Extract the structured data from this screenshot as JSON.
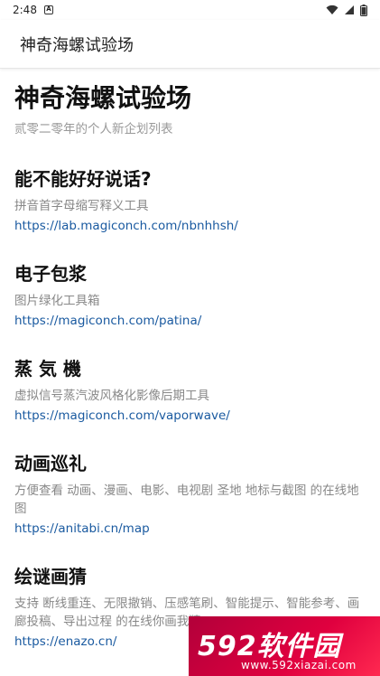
{
  "status": {
    "time": "2:48",
    "badge": "A"
  },
  "app_bar": {
    "title": "神奇海螺试验场"
  },
  "header": {
    "title": "神奇海螺试验场",
    "subtitle": "贰零二零年的个人新企划列表"
  },
  "projects": [
    {
      "title": "能不能好好说话?",
      "desc": "拼音首字母缩写释义工具",
      "link": "https://lab.magiconch.com/nbnhhsh/"
    },
    {
      "title": "电子包浆",
      "desc": "图片绿化工具箱",
      "link": "https://magiconch.com/patina/"
    },
    {
      "title": "蒸 気 機",
      "desc": "虚拟信号蒸汽波风格化影像后期工具",
      "link": "https://magiconch.com/vaporwave/"
    },
    {
      "title": "动画巡礼",
      "desc": "方便查看 动画、漫画、电影、电视剧 圣地 地标与截图 的在线地图",
      "link": "https://anitabi.cn/map"
    },
    {
      "title": "绘谜画猜",
      "desc": "支持 断线重连、无限撤销、压感笔刷、智能提示、智能参考、画廊投稿、导出过程 的在线你画我猜",
      "link": "https://enazo.cn/"
    }
  ],
  "watermark": {
    "main": "592软件园",
    "url": "www.592xiazai.com"
  },
  "colors": {
    "link": "#1a5aa0",
    "subtitle": "#999999",
    "watermark": "#e0003f"
  }
}
